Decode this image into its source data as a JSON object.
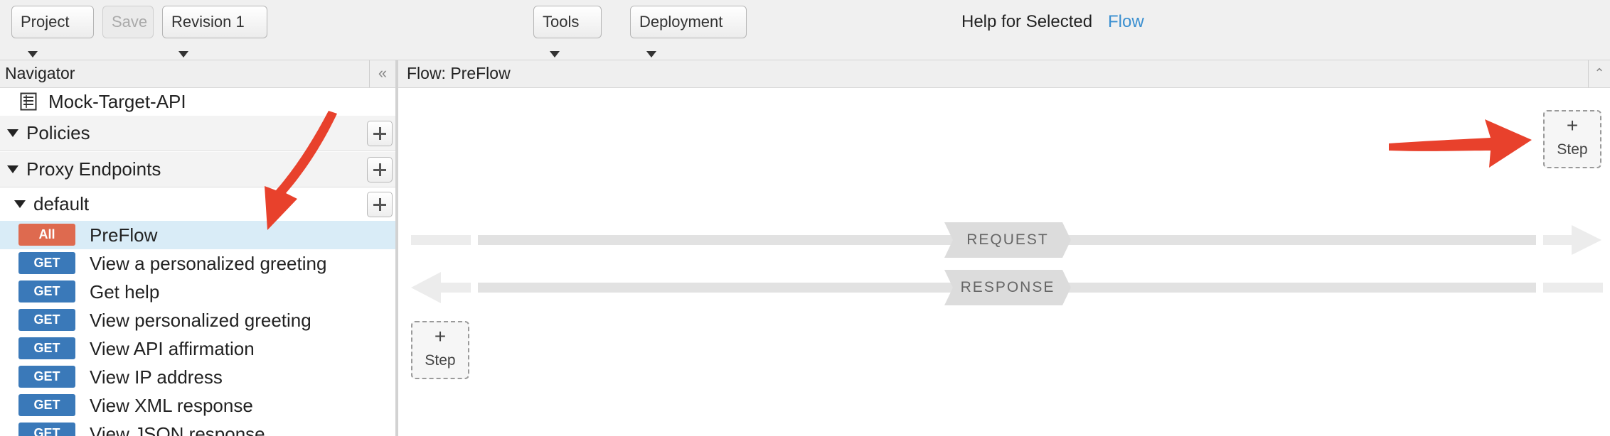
{
  "toolbar": {
    "project_label": "Project",
    "save_label": "Save",
    "revision_label": "Revision 1",
    "tools_label": "Tools",
    "deployment_label": "Deployment",
    "help_text": "Help for Selected",
    "help_link": "Flow"
  },
  "navigator": {
    "title": "Navigator",
    "collapse_glyph": "«",
    "api_name": "Mock-Target-API",
    "policies_label": "Policies",
    "proxy_endpoints_label": "Proxy Endpoints",
    "default_label": "default",
    "flows": [
      {
        "method": "All",
        "label": "PreFlow"
      },
      {
        "method": "GET",
        "label": "View a personalized greeting"
      },
      {
        "method": "GET",
        "label": "Get help"
      },
      {
        "method": "GET",
        "label": "View personalized greeting"
      },
      {
        "method": "GET",
        "label": "View API affirmation"
      },
      {
        "method": "GET",
        "label": "View IP address"
      },
      {
        "method": "GET",
        "label": "View XML response"
      },
      {
        "method": "GET",
        "label": "View JSON response"
      }
    ]
  },
  "flow_panel": {
    "title": "Flow: PreFlow",
    "collapse_glyph": "⌃",
    "request_label": "REQUEST",
    "response_label": "RESPONSE",
    "step_plus": "+",
    "step_label": "Step"
  },
  "colors": {
    "annotation_arrow": "#e8412c",
    "get_badge": "#3a79b9",
    "all_badge": "#de6a4f",
    "link": "#3a8fd0",
    "selected_row": "#d9ecf7"
  },
  "icons": {
    "api_icon": "document-list-icon",
    "expand": "triangle-down-icon",
    "add": "plus-icon"
  }
}
